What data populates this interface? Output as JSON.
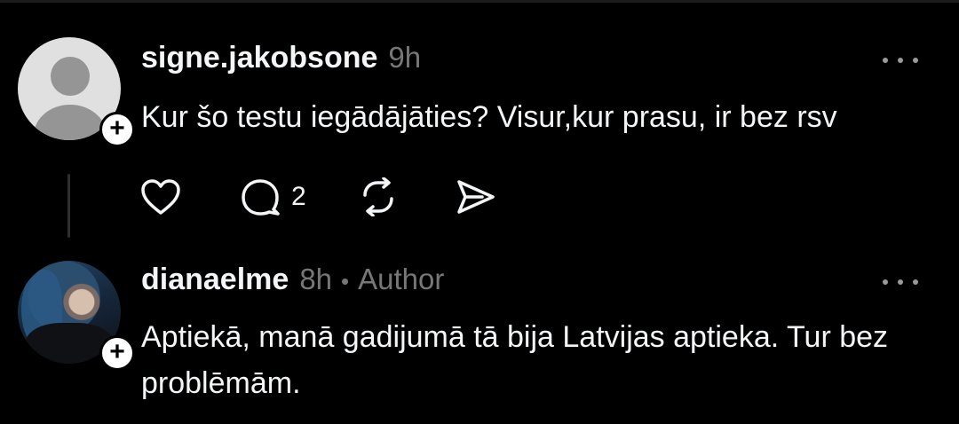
{
  "colors": {
    "background": "#000000",
    "text_primary": "#f3f5f7",
    "text_secondary": "#777777"
  },
  "posts": [
    {
      "username": "signe.jakobsone",
      "time": "9h",
      "author_tag": "",
      "text": "Kur šo testu iegādājāties? Visur,kur prasu, ir bez rsv",
      "avatar": "default-avatar",
      "actions": {
        "like_icon": "heart-icon",
        "comment_icon": "comment-icon",
        "comment_count": "2",
        "repost_icon": "repost-icon",
        "share_icon": "send-icon"
      }
    },
    {
      "username": "dianaelme",
      "time": "8h",
      "separator": "•",
      "author_tag": "Author",
      "text": "Aptiekā, manā gadijumā tā bija Latvijas aptieka. Tur bez problēmām.",
      "avatar": "photo-avatar"
    }
  ],
  "icons": {
    "follow": "+",
    "more": "more-horizontal-icon"
  }
}
